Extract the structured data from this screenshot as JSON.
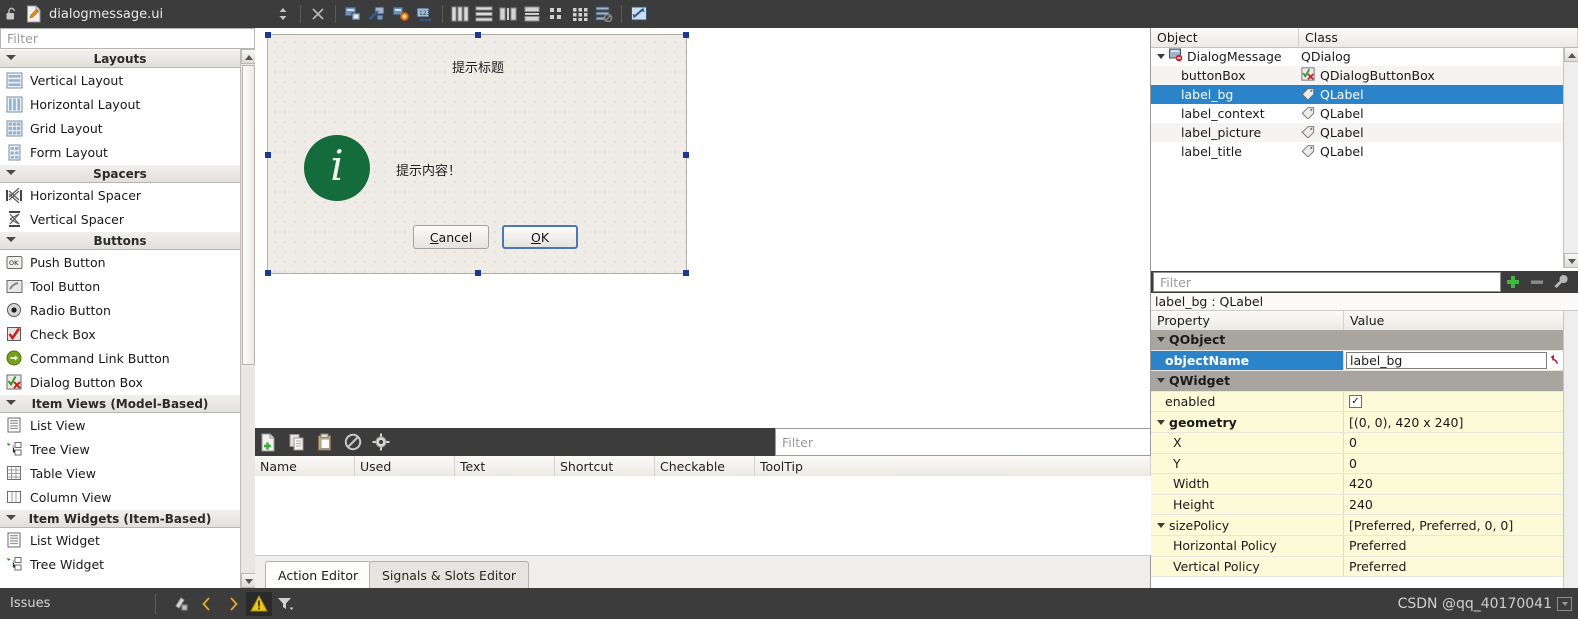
{
  "topbar": {
    "title": "dialogmessage.ui",
    "lock_icon": "unlock-icon",
    "file_icon": "ui-file-icon",
    "tools": [
      {
        "name": "updown-spinner-icon",
        "glyph": "spinner"
      },
      {
        "name": "close-icon",
        "glyph": "close"
      },
      {
        "name": "edit-widgets-icon",
        "glyph": "widget"
      },
      {
        "name": "edit-signals-slots-icon",
        "glyph": "signal"
      },
      {
        "name": "edit-buddies-icon",
        "glyph": "buddy"
      },
      {
        "name": "edit-tab-order-icon",
        "glyph": "taborder"
      },
      {
        "name": "layout-horizontally-icon",
        "glyph": "lay-h"
      },
      {
        "name": "layout-vertically-icon",
        "glyph": "lay-v"
      },
      {
        "name": "layout-splitter-horizontal-icon",
        "glyph": "split-h"
      },
      {
        "name": "layout-splitter-vertical-icon",
        "glyph": "split-v"
      },
      {
        "name": "layout-form-icon",
        "glyph": "form"
      },
      {
        "name": "layout-grid-icon",
        "glyph": "grid"
      },
      {
        "name": "break-layout-icon",
        "glyph": "break"
      },
      {
        "name": "adjust-size-icon",
        "glyph": "adjust"
      }
    ]
  },
  "widget_box": {
    "filter_placeholder": "Filter",
    "categories": [
      {
        "label": "Layouts",
        "items": [
          {
            "label": "Vertical Layout",
            "icon": "vertical-layout-icon"
          },
          {
            "label": "Horizontal Layout",
            "icon": "horizontal-layout-icon"
          },
          {
            "label": "Grid Layout",
            "icon": "grid-layout-icon"
          },
          {
            "label": "Form Layout",
            "icon": "form-layout-icon"
          }
        ]
      },
      {
        "label": "Spacers",
        "items": [
          {
            "label": "Horizontal Spacer",
            "icon": "horizontal-spacer-icon"
          },
          {
            "label": "Vertical Spacer",
            "icon": "vertical-spacer-icon"
          }
        ]
      },
      {
        "label": "Buttons",
        "items": [
          {
            "label": "Push Button",
            "icon": "push-button-icon"
          },
          {
            "label": "Tool Button",
            "icon": "tool-button-icon"
          },
          {
            "label": "Radio Button",
            "icon": "radio-button-icon"
          },
          {
            "label": "Check Box",
            "icon": "check-box-icon"
          },
          {
            "label": "Command Link Button",
            "icon": "command-link-icon"
          },
          {
            "label": "Dialog Button Box",
            "icon": "dialog-button-box-icon"
          }
        ]
      },
      {
        "label": "Item Views (Model-Based)",
        "items": [
          {
            "label": "List View",
            "icon": "list-view-icon"
          },
          {
            "label": "Tree View",
            "icon": "tree-view-icon"
          },
          {
            "label": "Table View",
            "icon": "table-view-icon"
          },
          {
            "label": "Column View",
            "icon": "column-view-icon"
          }
        ]
      },
      {
        "label": "Item Widgets (Item-Based)",
        "items": [
          {
            "label": "List Widget",
            "icon": "list-widget-icon"
          },
          {
            "label": "Tree Widget",
            "icon": "tree-widget-icon"
          }
        ]
      }
    ]
  },
  "form": {
    "title": "提示标题",
    "context": "提示内容！",
    "icon_letter": "i",
    "icon_color": "#146B3C",
    "buttons": [
      {
        "label_before": "C",
        "label_after": "ancel",
        "focused": false
      },
      {
        "label_before": "O",
        "label_after": "K",
        "focused": true
      }
    ]
  },
  "object_inspector": {
    "columns": [
      "Object",
      "Class"
    ],
    "rows": [
      {
        "name": "DialogMessage",
        "class": "QDialog",
        "icon": "dialog-icon",
        "expander": true,
        "selected": false,
        "indent": 0
      },
      {
        "name": "buttonBox",
        "class": "QDialogButtonBox",
        "icon": "dialog-button-box-icon",
        "selected": false,
        "indent": 1
      },
      {
        "name": "label_bg",
        "class": "QLabel",
        "icon": "label-icon",
        "selected": true,
        "indent": 1
      },
      {
        "name": "label_context",
        "class": "QLabel",
        "icon": "label-icon",
        "selected": false,
        "indent": 1
      },
      {
        "name": "label_picture",
        "class": "QLabel",
        "icon": "label-icon",
        "selected": false,
        "indent": 1
      },
      {
        "name": "label_title",
        "class": "QLabel",
        "icon": "label-icon",
        "selected": false,
        "indent": 1
      }
    ]
  },
  "property_editor": {
    "filter_placeholder": "Filter",
    "object_header": "label_bg : QLabel",
    "columns": [
      "Property",
      "Value"
    ],
    "toolbar_icons": [
      {
        "name": "add-property-icon",
        "glyph": "plus"
      },
      {
        "name": "remove-property-icon",
        "glyph": "minus"
      },
      {
        "name": "configure-icon",
        "glyph": "wrench"
      }
    ],
    "rows": [
      {
        "kind": "group",
        "property": "QObject",
        "value": "",
        "expander": true
      },
      {
        "kind": "selected-edit",
        "property": "objectName",
        "value": "label_bg",
        "revert_icon": "revert-icon"
      },
      {
        "kind": "group",
        "property": "QWidget",
        "value": "",
        "expander": true
      },
      {
        "kind": "check",
        "property": "enabled",
        "value": "✓"
      },
      {
        "kind": "bold",
        "property": "geometry",
        "value": "[(0, 0), 420 x 240]",
        "expander": true
      },
      {
        "kind": "sub",
        "property": "X",
        "value": "0"
      },
      {
        "kind": "sub",
        "property": "Y",
        "value": "0"
      },
      {
        "kind": "sub",
        "property": "Width",
        "value": "420"
      },
      {
        "kind": "sub",
        "property": "Height",
        "value": "240"
      },
      {
        "kind": "normal",
        "property": "sizePolicy",
        "value": "[Preferred, Preferred, 0, 0]",
        "expander": true
      },
      {
        "kind": "sub",
        "property": "Horizontal Policy",
        "value": "Preferred"
      },
      {
        "kind": "sub",
        "property": "Vertical Policy",
        "value": "Preferred"
      }
    ]
  },
  "action_editor": {
    "filter_placeholder": "Filter",
    "toolbar_icons": [
      {
        "name": "new-action-icon",
        "glyph": "new"
      },
      {
        "name": "copy-icon",
        "glyph": "copy"
      },
      {
        "name": "paste-icon",
        "glyph": "paste"
      },
      {
        "name": "delete-action-icon",
        "glyph": "forbidden"
      },
      {
        "name": "edit-action-icon",
        "glyph": "gear"
      }
    ],
    "columns": [
      "Name",
      "Used",
      "Text",
      "Shortcut",
      "Checkable",
      "ToolTip"
    ],
    "rows": []
  },
  "bottom_tabs": [
    {
      "label": "Action Editor",
      "active": true
    },
    {
      "label": "Signals & Slots Editor",
      "active": false
    }
  ],
  "status_bar": {
    "label": "Issues",
    "icons": [
      {
        "name": "clear-issues-icon",
        "glyph": "broom"
      },
      {
        "name": "previous-issue-icon",
        "glyph": "prev"
      },
      {
        "name": "next-issue-icon",
        "glyph": "next"
      },
      {
        "name": "warning-icon",
        "glyph": "warn"
      },
      {
        "name": "filter-icon",
        "glyph": "filter"
      }
    ],
    "watermark": "CSDN @qq_40170041"
  }
}
